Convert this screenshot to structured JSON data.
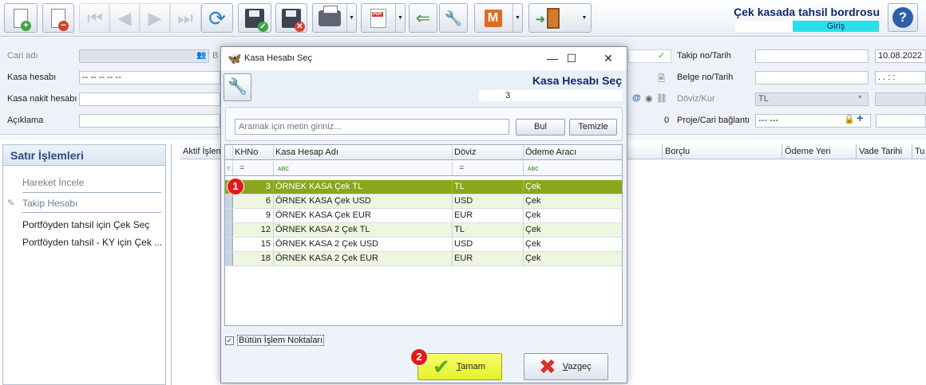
{
  "toolbar": {
    "buttons": [
      {
        "name": "new-document-icon"
      },
      {
        "name": "delete-document-icon"
      },
      {
        "name": "first-record-icon",
        "glyph": "⏮"
      },
      {
        "name": "previous-record-icon",
        "glyph": "◀"
      },
      {
        "name": "next-record-icon",
        "glyph": "▶"
      },
      {
        "name": "last-record-icon",
        "glyph": "⏭"
      },
      {
        "name": "refresh-icon",
        "glyph": "⟳"
      },
      {
        "name": "save-icon"
      },
      {
        "name": "save-and-close-icon"
      },
      {
        "name": "print-icon"
      },
      {
        "name": "pdf-export-icon",
        "text": "PDF"
      },
      {
        "name": "import-icon",
        "glyph": "⇐"
      },
      {
        "name": "tools-icon",
        "glyph": "🔧"
      },
      {
        "name": "m-module-icon",
        "text": "M"
      },
      {
        "name": "exit-icon"
      }
    ],
    "doc_title": "Çek kasada tahsil bordrosu",
    "mode_badge": "Giriş",
    "help_glyph": "?"
  },
  "form": {
    "left_labels": [
      "Cari adı",
      "Kasa hesabı",
      "Kasa nakit hesabı",
      "Açıklama"
    ],
    "kasa_hesabi_value": "-- -- -- -- --",
    "cari_button_letter": "B",
    "aciklama_right_value": "0",
    "right_labels": [
      "Takip no/Tarih",
      "Belge no/Tarih",
      "Döviz/Kur",
      "Proje/Cari bağlantı"
    ],
    "takip_tarih": "10.08.2022",
    "belge_tarih": ".   .     : :",
    "doviz": "TL",
    "proje_value": "--- ---"
  },
  "side_panel": {
    "title": "Satır İşlemleri",
    "items": [
      "Hareket İncele",
      "Takip Hesabı",
      "Portföyden tahsil için Çek Seç",
      "Portföyden tahsil - KY için Çek ..."
    ]
  },
  "background_grid": {
    "columns": [
      "Aktif İşlem",
      "Borçlu",
      "Ödeme Yeri",
      "Vade Tarihi",
      "Tu"
    ]
  },
  "dialog": {
    "window_title": "Kasa Hesabı Seç",
    "heading": "Kasa Hesabı Seç",
    "record_no": "3",
    "search": {
      "placeholder": "Aramak için metin giriniz...",
      "find_label": "Bul",
      "clear_label": "Temizle"
    },
    "columns": [
      "KHNo",
      "Kasa Hesap Adı",
      "Döviz",
      "Ödeme Aracı"
    ],
    "filter": {
      "khno": "=",
      "name": "ᴀʙc",
      "doviz": "=",
      "odeme": "ᴀʙc"
    },
    "rows": [
      {
        "khno": "3",
        "name": "ÖRNEK KASA Çek TL",
        "doviz": "TL",
        "odeme": "Çek"
      },
      {
        "khno": "6",
        "name": "ÖRNEK KASA Çek USD",
        "doviz": "USD",
        "odeme": "Çek"
      },
      {
        "khno": "9",
        "name": "ÖRNEK KASA Çek EUR",
        "doviz": "EUR",
        "odeme": "Çek"
      },
      {
        "khno": "12",
        "name": "ÖRNEK KASA 2 Çek TL",
        "doviz": "TL",
        "odeme": "Çek"
      },
      {
        "khno": "15",
        "name": "ÖRNEK KASA 2 Çek USD",
        "doviz": "USD",
        "odeme": "Çek"
      },
      {
        "khno": "18",
        "name": "ÖRNEK KASA 2 Çek EUR",
        "doviz": "EUR",
        "odeme": "Çek"
      }
    ],
    "checkbox_label": "Bütün İşlem Noktaları",
    "checkbox_checked": true,
    "ok_label_underlined": "T",
    "ok_label_rest": "amam",
    "cancel_label_underlined": "V",
    "cancel_label_rest": "azgeç"
  },
  "markers": [
    "1",
    "2"
  ],
  "colors": {
    "selected_row": "#8aa61a",
    "ok_button": "#e5f22a",
    "mode_badge": "#2ae0ea",
    "marker": "#e01b1b"
  }
}
